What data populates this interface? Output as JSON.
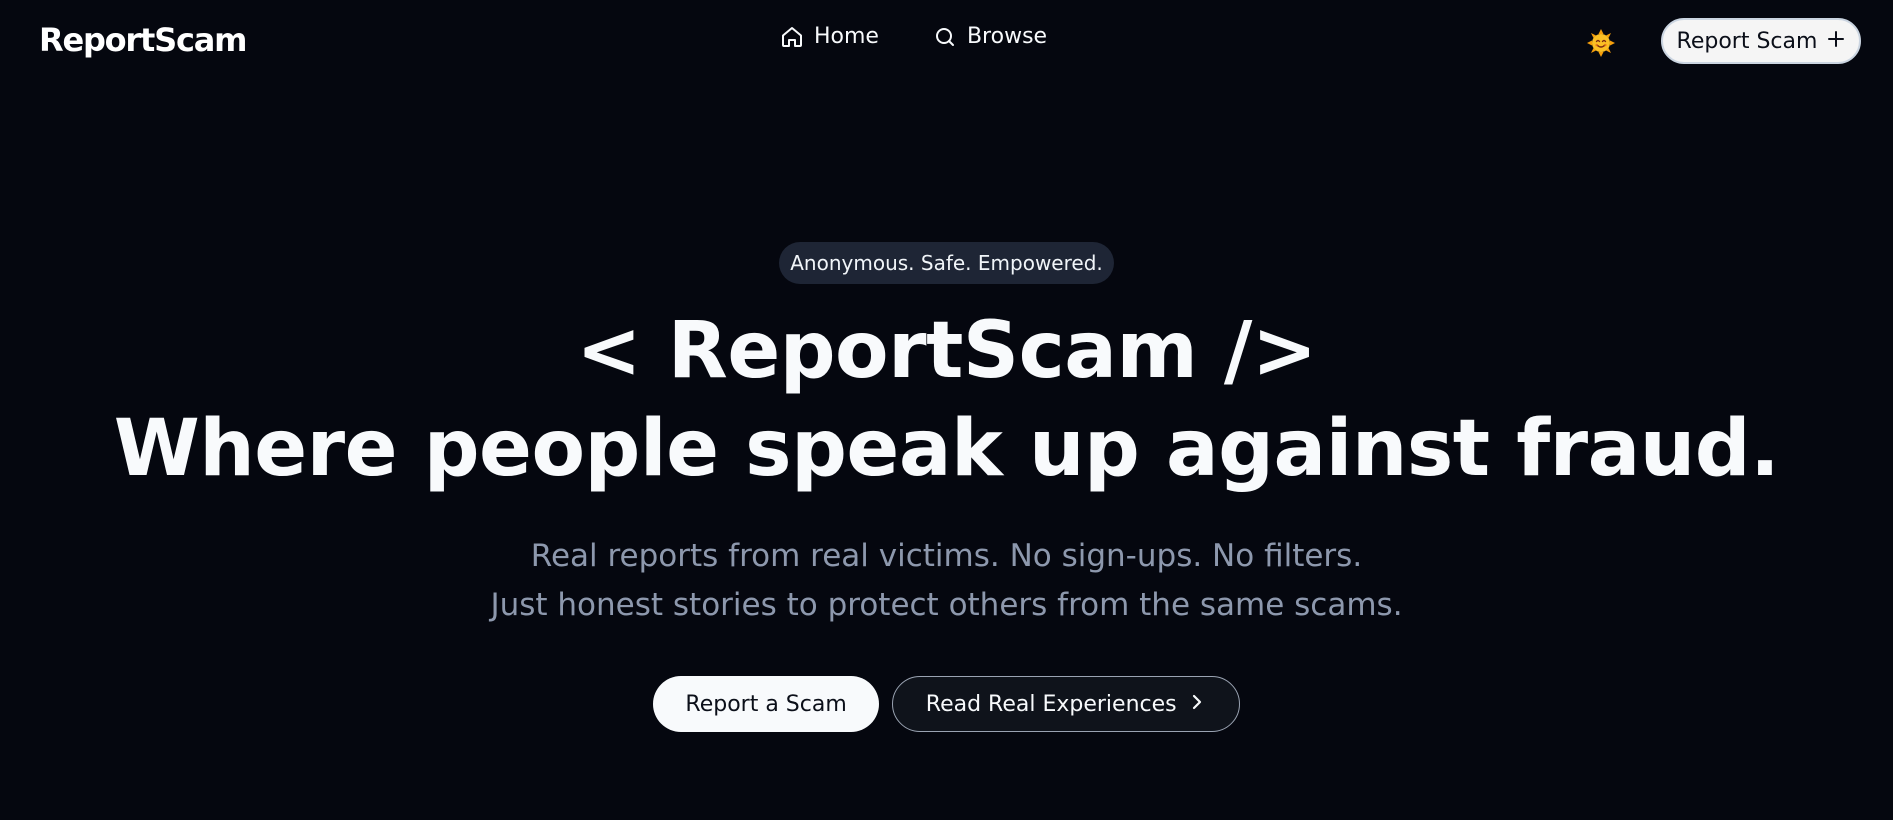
{
  "navbar": {
    "brand": "ReportScam",
    "links": [
      {
        "label": "Home",
        "icon": "home-icon"
      },
      {
        "label": "Browse",
        "icon": "search-icon"
      }
    ],
    "theme_toggle_icon": "sun-emoji-icon",
    "report_button_label": "Report Scam",
    "report_button_icon": "plus-icon"
  },
  "hero": {
    "tagline": "Anonymous. Safe. Empowered.",
    "headline_line1": "< ReportScam />",
    "headline_line2": "Where people speak up against fraud.",
    "subtext_line1": "Real reports from real victims. No sign-ups. No filters.",
    "subtext_line2": "Just honest stories to protect others from the same scams.",
    "primary_button": "Report a Scam",
    "secondary_button": "Read Real Experiences",
    "secondary_button_icon": "chevron-right-icon"
  },
  "colors": {
    "background": "#05070f",
    "text": "#f8fafc",
    "muted_text": "#8d98ad",
    "pill_background": "#1e2535"
  }
}
